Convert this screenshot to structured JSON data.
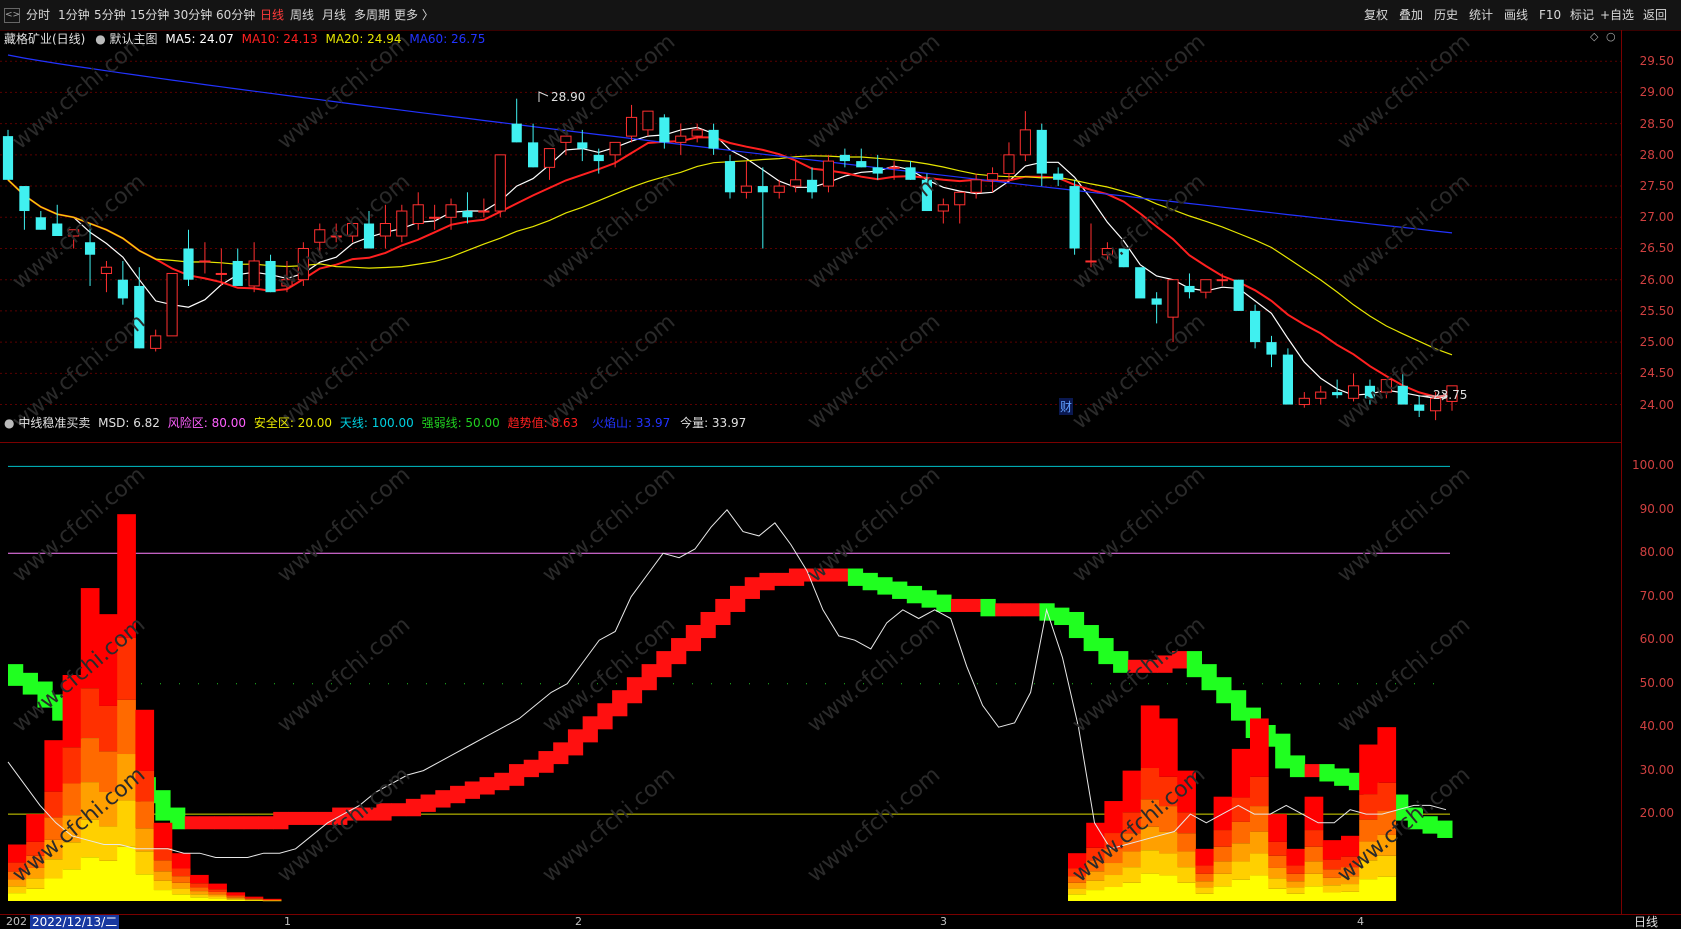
{
  "toolbar": {
    "collapse_label": "<>",
    "periods": [
      "分时",
      "1分钟",
      "5分钟",
      "15分钟",
      "30分钟",
      "60分钟",
      "日线",
      "周线",
      "月线",
      "多周期",
      "更多 〉"
    ],
    "active_period": "日线",
    "right_buttons": [
      "复权",
      "叠加",
      "历史",
      "统计",
      "画线",
      "F10",
      "标记",
      "+自选",
      "返回"
    ]
  },
  "main_legend": {
    "stock": "藏格矿业(日线)",
    "template": "默认主图",
    "ma5": "MA5: 24.07",
    "ma10": "MA10: 24.13",
    "ma20": "MA20: 24.94",
    "ma60": "MA60: 26.75",
    "colors": {
      "ma5": "#ffffff",
      "ma10": "#ff2020",
      "ma20": "#e6e600",
      "ma60": "#2020ff"
    }
  },
  "main_annotations": {
    "high": "28.90",
    "low": "23.75",
    "finance_mark": "财"
  },
  "indicator_legend": {
    "name": "中线稳准买卖",
    "msd": "MSD: 6.82",
    "risk": "风险区: 80.00",
    "safe": "安全区: 20.00",
    "sky": "天线: 100.00",
    "strong": "强弱线: 50.00",
    "trend": "趋势值: 8.63",
    "volcano": "火焰山: 33.97",
    "today": "今量: 33.97"
  },
  "bottom": {
    "date": "2022/12/13/二",
    "year_stub": "202",
    "months": [
      "1",
      "2",
      "3",
      "4"
    ],
    "period_label": "日线"
  },
  "chart_data": [
    {
      "type": "candlestick",
      "title": "藏格矿业(日线)",
      "y_ticks": [
        "29.50",
        "29.00",
        "28.50",
        "28.00",
        "27.50",
        "27.00",
        "26.50",
        "26.00",
        "25.50",
        "25.00",
        "24.50",
        "24.00"
      ],
      "ylim": [
        23.4,
        30.0
      ],
      "ohlc": [
        [
          28.3,
          28.4,
          27.6,
          27.6
        ],
        [
          27.5,
          27.5,
          26.8,
          27.1
        ],
        [
          27.0,
          27.1,
          26.8,
          26.8
        ],
        [
          26.9,
          27.2,
          26.7,
          26.7
        ],
        [
          26.7,
          26.8,
          26.5,
          26.8
        ],
        [
          26.6,
          26.9,
          25.9,
          26.4
        ],
        [
          26.1,
          26.3,
          25.8,
          26.2
        ],
        [
          26.0,
          26.3,
          25.6,
          25.7
        ],
        [
          25.9,
          26.2,
          24.9,
          24.9
        ],
        [
          24.9,
          25.2,
          24.85,
          25.1
        ],
        [
          25.1,
          26.1,
          25.1,
          26.1
        ],
        [
          26.5,
          26.8,
          25.9,
          26.0
        ],
        [
          26.3,
          26.6,
          26.1,
          26.3
        ],
        [
          26.1,
          26.5,
          25.9,
          26.1
        ],
        [
          26.3,
          26.5,
          25.9,
          25.9
        ],
        [
          25.9,
          26.6,
          25.8,
          26.3
        ],
        [
          26.3,
          26.4,
          25.8,
          25.8
        ],
        [
          25.9,
          26.3,
          25.8,
          26.0
        ],
        [
          26.0,
          26.6,
          25.9,
          26.5
        ],
        [
          26.6,
          26.9,
          26.4,
          26.8
        ],
        [
          26.7,
          26.9,
          26.6,
          26.7
        ],
        [
          26.7,
          26.9,
          26.6,
          26.9
        ],
        [
          26.9,
          27.1,
          26.5,
          26.5
        ],
        [
          26.7,
          27.2,
          26.5,
          26.9
        ],
        [
          26.7,
          27.2,
          26.6,
          27.1
        ],
        [
          26.9,
          27.4,
          26.8,
          27.2
        ],
        [
          27.0,
          27.2,
          26.8,
          27.0
        ],
        [
          27.0,
          27.3,
          26.8,
          27.2
        ],
        [
          27.1,
          27.4,
          26.9,
          27.0
        ],
        [
          27.1,
          27.3,
          27.0,
          27.1
        ],
        [
          27.1,
          28.0,
          27.0,
          28.0
        ],
        [
          28.5,
          28.9,
          28.2,
          28.2
        ],
        [
          28.2,
          28.5,
          27.8,
          27.8
        ],
        [
          27.8,
          28.1,
          27.6,
          28.1
        ],
        [
          28.2,
          28.3,
          28.0,
          28.3
        ],
        [
          28.2,
          28.4,
          27.9,
          28.1
        ],
        [
          28.0,
          28.1,
          27.7,
          27.9
        ],
        [
          28.0,
          28.2,
          27.8,
          28.2
        ],
        [
          28.3,
          28.8,
          28.2,
          28.6
        ],
        [
          28.4,
          28.7,
          28.3,
          28.7
        ],
        [
          28.6,
          28.65,
          28.1,
          28.2
        ],
        [
          28.2,
          28.5,
          28.0,
          28.3
        ],
        [
          28.3,
          28.5,
          28.2,
          28.4
        ],
        [
          28.4,
          28.5,
          28.0,
          28.1
        ],
        [
          27.9,
          28.0,
          27.3,
          27.4
        ],
        [
          27.4,
          27.9,
          27.3,
          27.5
        ],
        [
          27.5,
          27.8,
          26.5,
          27.4
        ],
        [
          27.4,
          27.6,
          27.3,
          27.5
        ],
        [
          27.5,
          27.9,
          27.4,
          27.6
        ],
        [
          27.6,
          27.8,
          27.3,
          27.4
        ],
        [
          27.5,
          28.0,
          27.4,
          27.9
        ],
        [
          28.0,
          28.1,
          27.8,
          27.9
        ],
        [
          27.9,
          28.1,
          27.8,
          27.8
        ],
        [
          27.8,
          28.0,
          27.6,
          27.7
        ],
        [
          27.8,
          27.9,
          27.6,
          27.8
        ],
        [
          27.8,
          27.9,
          27.6,
          27.6
        ],
        [
          27.6,
          27.7,
          27.1,
          27.1
        ],
        [
          27.1,
          27.3,
          26.9,
          27.2
        ],
        [
          27.2,
          27.4,
          26.9,
          27.4
        ],
        [
          27.4,
          27.7,
          27.3,
          27.6
        ],
        [
          27.6,
          27.8,
          27.4,
          27.7
        ],
        [
          27.7,
          28.2,
          27.6,
          28.0
        ],
        [
          28.0,
          28.7,
          27.9,
          28.4
        ],
        [
          28.4,
          28.5,
          27.5,
          27.7
        ],
        [
          27.7,
          27.8,
          27.5,
          27.6
        ],
        [
          27.5,
          27.6,
          26.4,
          26.5
        ],
        [
          26.3,
          26.9,
          26.2,
          26.3
        ],
        [
          26.4,
          26.6,
          26.3,
          26.5
        ],
        [
          26.5,
          26.5,
          26.2,
          26.2
        ],
        [
          26.2,
          26.1,
          25.8,
          25.7
        ],
        [
          25.7,
          25.8,
          25.3,
          25.6
        ],
        [
          25.4,
          26.0,
          25.0,
          26.0
        ],
        [
          25.9,
          26.1,
          25.7,
          25.8
        ],
        [
          25.8,
          26.0,
          25.7,
          26.0
        ],
        [
          26.0,
          26.1,
          25.9,
          26.0
        ],
        [
          26.0,
          26.0,
          25.5,
          25.5
        ],
        [
          25.5,
          25.6,
          24.9,
          25.0
        ],
        [
          25.0,
          25.1,
          24.6,
          24.8
        ],
        [
          24.8,
          24.9,
          24.0,
          24.0
        ],
        [
          24.0,
          24.2,
          23.95,
          24.1
        ],
        [
          24.1,
          24.3,
          24.0,
          24.2
        ],
        [
          24.2,
          24.4,
          24.1,
          24.15
        ],
        [
          24.1,
          24.5,
          24.05,
          24.3
        ],
        [
          24.3,
          24.4,
          24.0,
          24.1
        ],
        [
          24.2,
          24.4,
          24.1,
          24.4
        ],
        [
          24.3,
          24.5,
          24.0,
          24.0
        ],
        [
          24.0,
          24.15,
          23.8,
          23.9
        ],
        [
          23.9,
          24.2,
          23.75,
          24.1
        ],
        [
          24.05,
          24.3,
          23.9,
          24.3
        ]
      ],
      "ma5_last": 24.07,
      "ma10_last": 24.13,
      "ma20_last": 24.94,
      "ma60_last": 26.75,
      "marked_high": 28.9,
      "marked_low": 23.75
    },
    {
      "type": "area",
      "title": "中线稳准买卖",
      "y_ticks": [
        "100.00",
        "90.00",
        "80.00",
        "70.00",
        "60.00",
        "50.00",
        "40.00",
        "30.00",
        "20.00"
      ],
      "ylim": [
        0,
        104
      ],
      "reference_lines": {
        "sky": 100,
        "risk": 80,
        "strong": 50,
        "safe": 20
      },
      "trend_line": [
        53,
        51,
        49,
        46,
        43,
        41,
        37,
        33,
        30,
        27,
        24,
        20,
        18,
        18,
        18,
        18,
        18,
        18,
        18,
        19,
        19,
        19,
        19,
        20,
        20,
        20,
        21,
        21,
        22,
        23,
        24,
        25,
        26,
        27,
        28,
        30,
        31,
        33,
        35,
        38,
        41,
        44,
        47,
        50,
        53,
        56,
        59,
        62,
        65,
        68,
        71,
        73,
        74,
        74,
        75,
        75,
        75,
        75,
        74,
        73,
        72,
        71,
        70,
        69,
        68,
        68,
        68,
        67,
        67,
        67,
        67,
        66,
        65,
        62,
        59,
        56,
        54,
        54,
        54,
        55,
        56,
        53,
        50,
        47,
        43,
        39,
        37,
        32,
        30,
        30,
        29,
        28,
        27,
        25,
        23,
        20,
        18,
        17,
        16
      ],
      "msd_line": [
        32,
        27,
        22,
        18,
        15,
        14,
        13,
        13,
        12,
        12,
        12,
        11,
        11,
        10,
        10,
        10,
        11,
        11,
        12,
        15,
        18,
        20,
        22,
        25,
        27,
        29,
        30,
        32,
        34,
        36,
        38,
        40,
        42,
        45,
        48,
        50,
        55,
        60,
        62,
        70,
        75,
        80,
        79,
        81,
        86,
        90,
        85,
        84,
        87,
        82,
        76,
        67,
        61,
        60,
        58,
        64,
        67,
        65,
        67,
        65,
        54,
        45,
        40,
        41,
        48,
        67,
        56,
        40,
        18,
        12,
        13,
        14,
        15,
        16,
        20,
        18,
        20,
        22,
        20,
        20,
        22,
        20,
        18,
        18,
        21,
        20,
        20,
        21,
        22,
        22,
        21
      ],
      "flame_last": 33.97,
      "msd_last": 6.82,
      "trend_last": 8.63
    }
  ]
}
